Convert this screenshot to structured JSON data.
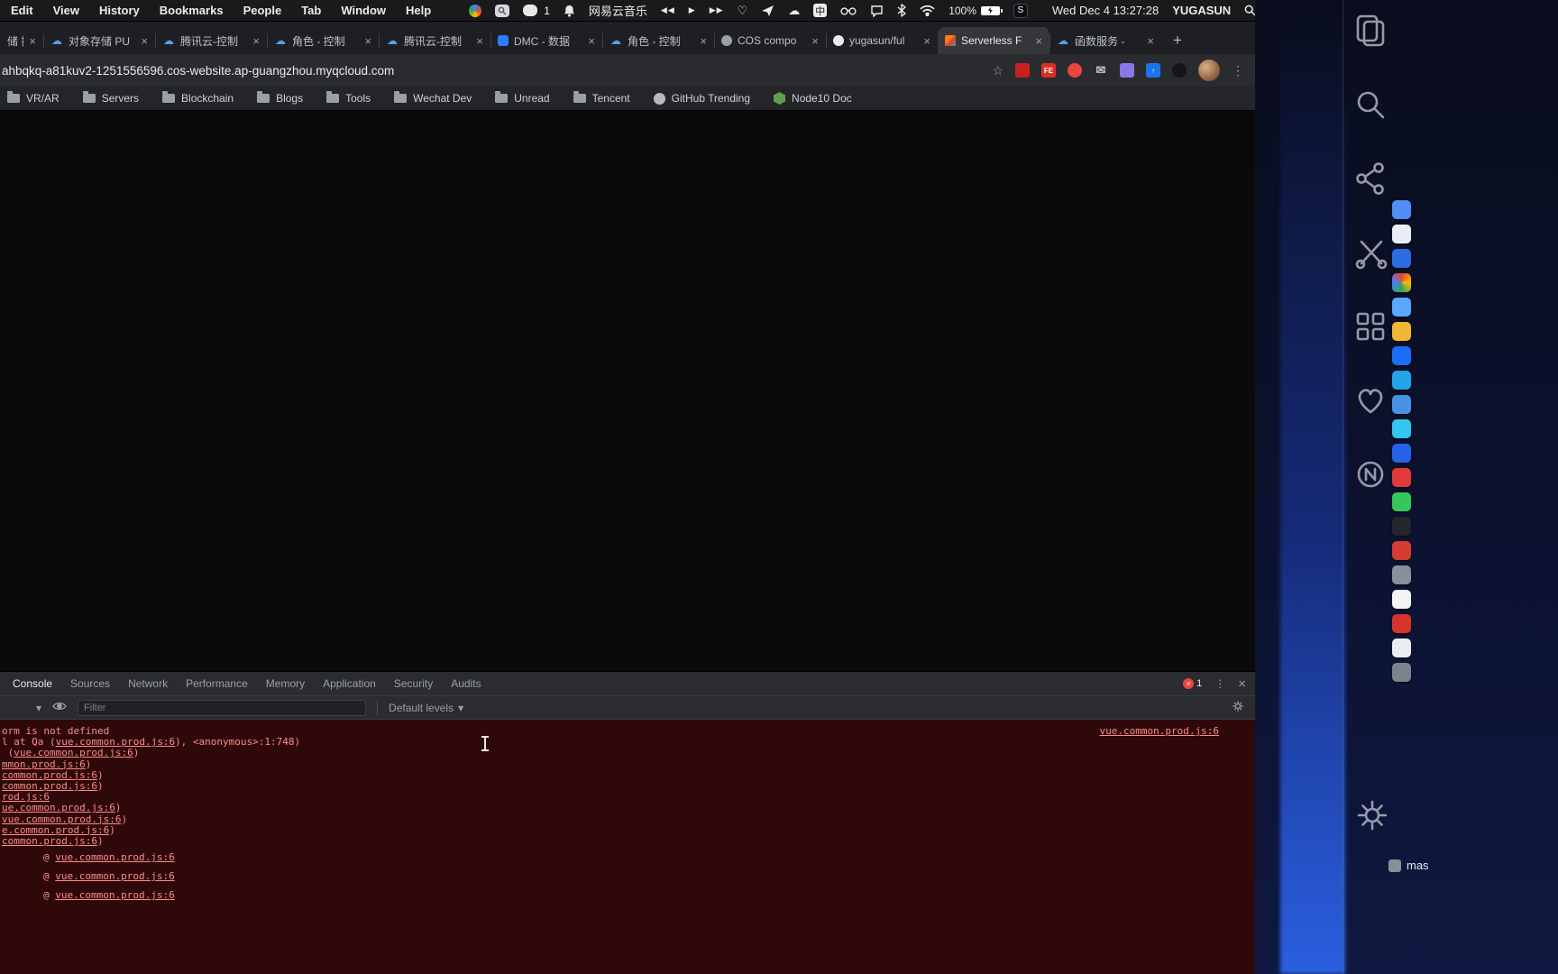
{
  "glyphs": {
    "close": "×",
    "plus": "+",
    "star": "☆",
    "kebab": "⋮",
    "caret": "▾",
    "heart": "♡",
    "cloud": "☁",
    "prev": "◀◀",
    "play": "▶",
    "next": "▶▶",
    "hamburger": "≡"
  },
  "menubar": {
    "menus": [
      "Edit",
      "View",
      "History",
      "Bookmarks",
      "People",
      "Tab",
      "Window",
      "Help"
    ],
    "wechat_badge": "1",
    "music_app": "网易云音乐",
    "ime_label": "中",
    "battery_percent": "100%",
    "s_app_label": "S",
    "clock": "Wed Dec 4  13:27:28",
    "username": "YUGASUN"
  },
  "browser": {
    "url": "ahbqkq-a81kuv2-1251556596.cos-website.ap-guangzhou.myqcloud.com",
    "tabs": [
      {
        "label": "储 操",
        "fav": "none",
        "w": 48
      },
      {
        "label": "对象存储 PU",
        "fav": "cloud"
      },
      {
        "label": "腾讯云-控制",
        "fav": "cloud"
      },
      {
        "label": "角色 - 控制",
        "fav": "cloud"
      },
      {
        "label": "腾讯云-控制",
        "fav": "cloud"
      },
      {
        "label": "DMC - 数据",
        "fav": "dmc"
      },
      {
        "label": "角色 - 控制",
        "fav": "cloud"
      },
      {
        "label": "COS compo",
        "fav": "github-dark"
      },
      {
        "label": "yugasun/ful",
        "fav": "github-light"
      },
      {
        "label": "Serverless F",
        "fav": "serverless",
        "active": true
      },
      {
        "label": "函数服务 -",
        "fav": "cloud"
      }
    ],
    "extensions": [
      {
        "name": "ext-red-square",
        "bg": "#c5221f",
        "shape": "square",
        "label": ""
      },
      {
        "name": "ext-fe",
        "bg": "#d93025",
        "shape": "square",
        "label": "FE"
      },
      {
        "name": "ext-red-circle",
        "bg": "#e8453c",
        "shape": "circle",
        "label": ""
      },
      {
        "name": "ext-mail",
        "bg": "",
        "shape": "glyph",
        "label": "✉"
      },
      {
        "name": "ext-puzzle",
        "bg": "#8a77e8",
        "shape": "square",
        "label": ""
      },
      {
        "name": "ext-uploader",
        "bg": "#1a73e8",
        "shape": "square",
        "label": "↑"
      },
      {
        "name": "ext-dark-circle",
        "bg": "#141518",
        "shape": "circle",
        "label": ""
      }
    ],
    "bookmarks": [
      {
        "label": "VR/AR",
        "icon": "folder"
      },
      {
        "label": "Servers",
        "icon": "folder"
      },
      {
        "label": "Blockchain",
        "icon": "folder"
      },
      {
        "label": "Blogs",
        "icon": "folder"
      },
      {
        "label": "Tools",
        "icon": "folder"
      },
      {
        "label": "Wechat Dev",
        "icon": "folder"
      },
      {
        "label": "Unread",
        "icon": "folder"
      },
      {
        "label": "Tencent",
        "icon": "folder"
      },
      {
        "label": "GitHub Trending",
        "icon": "github"
      },
      {
        "label": "Node10 Doc",
        "icon": "node"
      }
    ]
  },
  "devtools": {
    "tabs": [
      {
        "label": "Console",
        "active": true
      },
      {
        "label": "Sources"
      },
      {
        "label": "Network"
      },
      {
        "label": "Performance"
      },
      {
        "label": "Memory"
      },
      {
        "label": "Application"
      },
      {
        "label": "Security"
      },
      {
        "label": "Audits"
      }
    ],
    "error_badge_count": "1",
    "filter_placeholder": "Filter",
    "levels_label": "Default levels",
    "console_lines": [
      {
        "pre": "orm is not defined",
        "link": "",
        "post": "",
        "right": "vue.common.prod.js:6"
      },
      {
        "pre": "l at Qa (",
        "link": "vue.common.prod.js:6",
        "post": "), <anonymous>:1:748)"
      },
      {
        "pre": " (",
        "link": "vue.common.prod.js:6",
        "post": ")"
      },
      {
        "pre": "",
        "link": "mmon.prod.js:6",
        "post": ")"
      },
      {
        "pre": "",
        "link": "common.prod.js:6",
        "post": ")"
      },
      {
        "pre": "",
        "link": "common.prod.js:6",
        "post": ")"
      },
      {
        "pre": "",
        "link": "rod.js:6",
        "post": ""
      },
      {
        "pre": "",
        "link": "ue.common.prod.js:6",
        "post": ")"
      },
      {
        "pre": "",
        "link": "vue.common.prod.js:6",
        "post": ")"
      },
      {
        "pre": "",
        "link": "e.common.prod.js:6",
        "post": ")"
      },
      {
        "pre": "",
        "link": "common.prod.js:6",
        "post": ")"
      },
      {
        "pre": "@ ",
        "link": "vue.common.prod.js:6",
        "post": "",
        "stack": true
      },
      {
        "pre": "@ ",
        "link": "vue.common.prod.js:6",
        "post": "",
        "stack": true
      },
      {
        "pre": "@ ",
        "link": "vue.common.prod.js:6",
        "post": "",
        "stack": true
      }
    ]
  },
  "desktop": {
    "launcher_icons": [
      "clipboard",
      "search",
      "share",
      "scissors",
      "grid",
      "heart",
      "record"
    ],
    "dock_apps": [
      "#4f8df7",
      "#e8ecf5",
      "#2b6de0",
      "conic-gradient(#ea4335,#fbbc05,#34a853,#4285f4,#ea4335)",
      "#59a7ff",
      "#f2b636",
      "#1b6ef3",
      "#24a3e8",
      "#4a90e2",
      "#36c5f0",
      "#2563eb",
      "#e23a3a",
      "#35c75a",
      "#23262b",
      "#d43d32",
      "#8a909a",
      "#f2f3f5",
      "#d6342a",
      "#e9edf2",
      "#7d828c"
    ],
    "mas_label": "mas"
  }
}
